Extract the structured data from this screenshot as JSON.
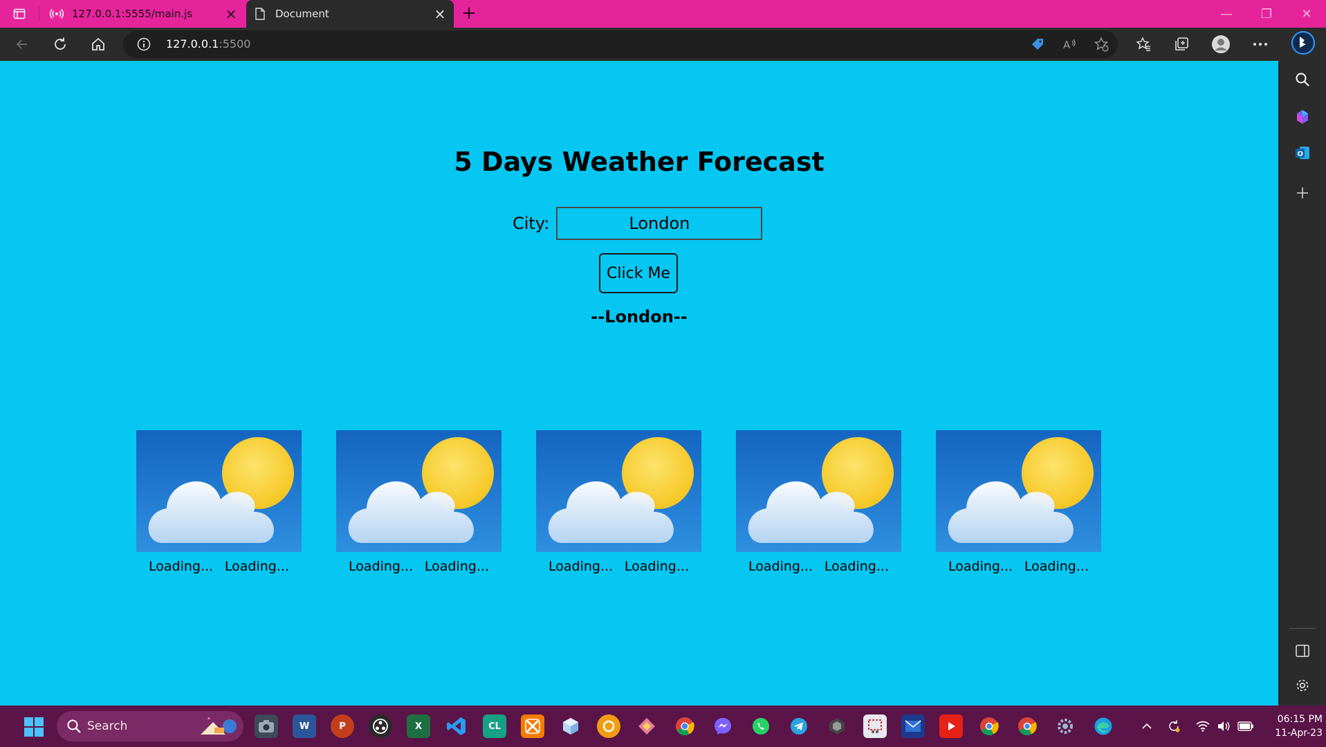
{
  "browser": {
    "tabs": [
      {
        "title": "127.0.0.1:5555/main.js",
        "active": false
      },
      {
        "title": "Document",
        "active": true
      }
    ],
    "address": {
      "host": "127.0.0.1",
      "port": ":5500"
    }
  },
  "page": {
    "heading": "5 Days Weather Forecast",
    "city_label": "City:",
    "city_value": "London",
    "button_label": "Click Me",
    "city_display": "--London--",
    "forecast_cards": [
      {
        "label_left": "Loading...",
        "label_right": "Loading...",
        "icon": "partly-cloudy-icon"
      },
      {
        "label_left": "Loading...",
        "label_right": "Loading...",
        "icon": "partly-cloudy-icon"
      },
      {
        "label_left": "Loading...",
        "label_right": "Loading...",
        "icon": "partly-cloudy-icon"
      },
      {
        "label_left": "Loading...",
        "label_right": "Loading...",
        "icon": "partly-cloudy-icon"
      },
      {
        "label_left": "Loading...",
        "label_right": "Loading...",
        "icon": "partly-cloudy-icon"
      }
    ]
  },
  "taskbar": {
    "search_label": "Search",
    "clock_time": "06:15 PM",
    "clock_date": "11-Apr-23"
  },
  "colors": {
    "tabbar": "#e5249b",
    "page_background": "#06c7f1",
    "taskbar": "#5a1448"
  }
}
